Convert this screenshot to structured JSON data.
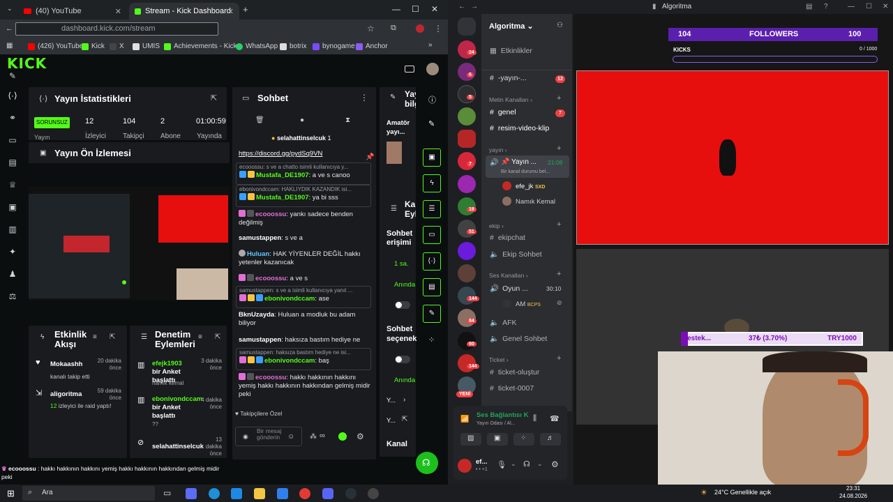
{
  "browser": {
    "tabs": [
      {
        "label": "(40) YouTube"
      },
      {
        "label": "Stream - Kick Dashboard"
      }
    ],
    "url": "dashboard.kick.com/stream",
    "bookmarks": [
      "(426) YouTube",
      "Kick",
      "X",
      "UMIS",
      "Achievements - Kick...",
      "WhatsApp",
      "botrix",
      "bynogame",
      "Anchor"
    ]
  },
  "kick": {
    "logo": "KICK",
    "stats": {
      "title": "Yayın İstatistikleri",
      "status": "SORUNSUZ",
      "items": [
        {
          "value": "12",
          "label": "İzleyici"
        },
        {
          "value": "104",
          "label": "Takipçi"
        },
        {
          "value": "2",
          "label": "Abone"
        },
        {
          "value": "01:00:59",
          "label": "Yayında"
        }
      ],
      "under_status": "Yayın"
    },
    "preview_title": "Yayın Ön İzlemesi",
    "activity": {
      "title": "Etkinlik Akışı",
      "items": [
        {
          "user": "Mokaashh",
          "text": "kanalı takip etti",
          "time": "20 dakika önce"
        },
        {
          "user": "aligoritma",
          "text_num": "12",
          "text": "izleyici ile raid yaptı!",
          "time": "59 dakika önce"
        }
      ]
    },
    "moderation": {
      "title": "Denetim Eylemleri",
      "items": [
        {
          "user": "efejk1903",
          "text": "bir Anket başlattı",
          "sub": "namık kemal",
          "time": "3 dakika önce"
        },
        {
          "user": "ebonivondccam",
          "text": "bir Anket başlattı",
          "sub": "??",
          "time": "4 dakika önce"
        },
        {
          "user": "selahattinselcuk",
          "text": "",
          "sub": "",
          "time": "13 dakika önce"
        }
      ]
    },
    "chat": {
      "title": "Sohbet",
      "pinned_user": "selahattinselcuk",
      "pinned_count": "1",
      "link": "https://discord.gg/pydSq9VN",
      "messages": [
        {
          "reply": "ecooossu: s ve a chatto isimli kullanıcıya y...",
          "user": "Mustafa_DE1907",
          "text": "a ve s canoo"
        },
        {
          "reply": "ebonivondccam: HAKLIYDIK KAZANDIK isi...",
          "user": "Mustafa_DE1907",
          "text": "ya bi sss"
        },
        {
          "user": "ecooossu",
          "text": "yankı sadece benden değilmiş"
        },
        {
          "user": "samustappen",
          "text": "s ve a"
        },
        {
          "user": "Huluan",
          "text": "HAK YİYENLER DEĞİL hakkı yetenler kazanıcak"
        },
        {
          "user": "ecooossu",
          "text": "a ve s"
        },
        {
          "reply": "samustappen: s ve a isimli kullanıcıya yanıt ...",
          "user": "ebonivondccam",
          "text": "ase"
        },
        {
          "user": "BknUzayda",
          "text": "Huluan a modluk bu adam biliyor"
        },
        {
          "user": "samustappen",
          "text": "haksıza bastım hediye ne"
        },
        {
          "reply": "samustappen: haksıza bastım hediye ne isi...",
          "user": "ebonivondccam",
          "text": "baş"
        },
        {
          "user": "ecooossu",
          "text": "hakkı hakkının hakkını yemiş hakkı hakkının hakkından gelmiş midir peki"
        }
      ],
      "followers_only": "Takipçilere Özel",
      "input_placeholder": "Bir mesaj gönderin"
    },
    "right_panel": {
      "title1": "Yayın bilgi",
      "amator": "Amatör yayı...",
      "kanal": "Kanal Eyle",
      "sohbet_erisimi": "Sohbet erişimi",
      "sa": "1 sa.",
      "aninda1": "Anında",
      "sohbet_secenek": "Sohbet seçenek",
      "aninda2": "Anında",
      "y1": "Y...",
      "y2": "Y...",
      "kanal2": "Kanal"
    },
    "bottom_msg_user": "ecooossu",
    "bottom_msg": "hakkı hakkının hakkını yemiş hakkı hakkının hakkından gelmiş midir peki"
  },
  "discord": {
    "title": "Algoritma",
    "server_name": "Algoritma",
    "channels": [
      {
        "type": "item",
        "label": "Etkinlikler"
      },
      {
        "type": "chan",
        "label": "-yayın-...",
        "ping": "12"
      },
      {
        "type": "cat",
        "label": "Metin Kanalları"
      },
      {
        "type": "chan",
        "label": "genel",
        "ping": "7"
      },
      {
        "type": "chan",
        "label": "resim-video-klip"
      },
      {
        "type": "cat",
        "label": "yayın"
      },
      {
        "type": "voice",
        "label": "Yayın ...",
        "time": "21:08",
        "sub": "Bir kanal durumu bel..."
      },
      {
        "type": "member",
        "label": "efe_jk",
        "tag": "SXD"
      },
      {
        "type": "member",
        "label": "Namık Kemal"
      },
      {
        "type": "cat",
        "label": "ekip"
      },
      {
        "type": "chan",
        "label": "ekipchat"
      },
      {
        "type": "voice2",
        "label": "Ekip Sohbet"
      },
      {
        "type": "cat",
        "label": "Ses Kanalları"
      },
      {
        "type": "voice",
        "label": "Oyun ...",
        "time": "30:10"
      },
      {
        "type": "member",
        "label": "AM",
        "tag": "BCPS"
      },
      {
        "type": "voice2",
        "label": "AFK"
      },
      {
        "type": "voice2",
        "label": "Genel Sohbet"
      },
      {
        "type": "cat",
        "label": "Ticket"
      },
      {
        "type": "chan",
        "label": "ticket-oluştur"
      },
      {
        "type": "chan",
        "label": "ticket-0007"
      }
    ],
    "server_badges": [
      "24",
      "6",
      "5",
      "7",
      "19",
      "51",
      "144",
      "84",
      "60",
      "144"
    ],
    "new_label": "YENİ",
    "voice_status": "Ses Bağlantısı K",
    "voice_sub": "Yayın Odası / Al...",
    "user_name": "ef...",
    "user_sub": "• • +1"
  },
  "overlay": {
    "followers_left": "104",
    "followers_label": "FOLLOWERS",
    "followers_right": "100",
    "kicks_label": "KICKS",
    "kicks_value": "0 / 1000",
    "kicks_progress": 0,
    "donation_left": "destek...",
    "donation_mid": "37₺ (3.70%)",
    "donation_right": "TRY1000",
    "donation_progress": 0.037
  },
  "taskbar": {
    "search": "Ara",
    "weather": "24°C  Genellikle açık",
    "time": "23:31",
    "date": "24.08.2026"
  },
  "colors": {
    "kick_green": "#53fc18",
    "discord_bg": "#2b2d31",
    "overlay_red": "#e70e0e",
    "followers_purple": "#5b1fae"
  }
}
